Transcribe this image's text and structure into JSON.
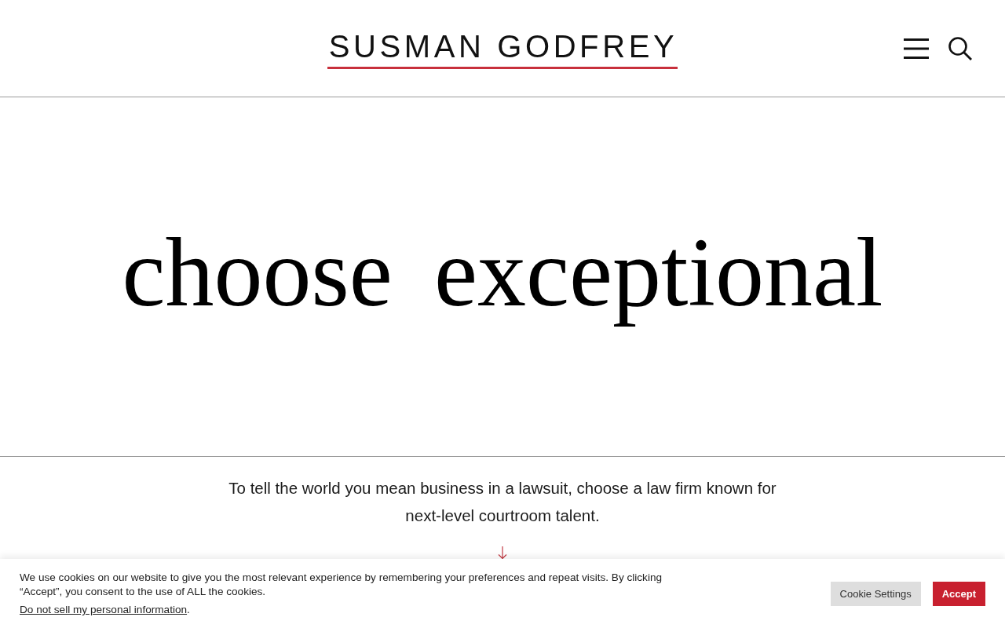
{
  "header": {
    "logo": "SUSMAN GODFREY"
  },
  "hero": {
    "headline": "choose exceptional"
  },
  "intro": {
    "text": "To tell the world you mean business in a lawsuit, choose a law firm known for next-level courtroom talent."
  },
  "cookie_banner": {
    "message": "We use cookies on our website to give you the most relevant experience by remembering your preferences and repeat visits. By clicking “Accept”, you consent to the use of ALL the cookies.",
    "link": "Do not sell my personal information",
    "link_suffix": ".",
    "buttons": [
      {
        "label": "Cookie Settings",
        "kind": "secondary"
      },
      {
        "label": "Accept",
        "kind": "primary"
      }
    ]
  }
}
